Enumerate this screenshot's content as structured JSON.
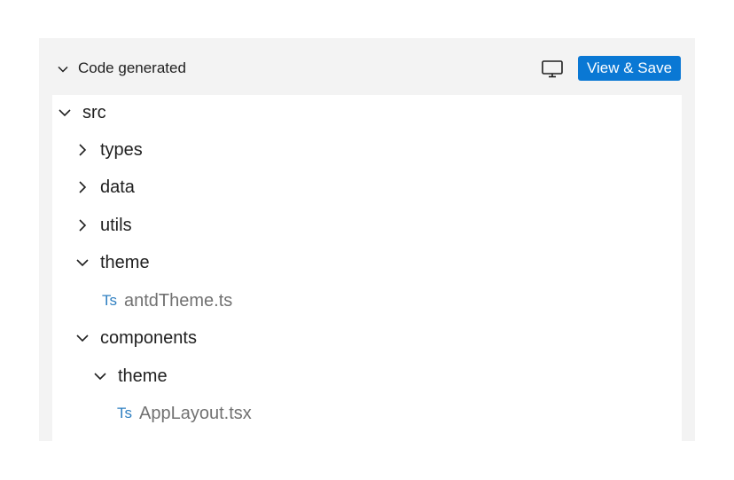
{
  "header": {
    "title": "Code generated",
    "view_save_label": "View & Save",
    "accent_color": "#0a78d4"
  },
  "tree": {
    "ts_icon_text": "Ts",
    "items": [
      {
        "label": "src",
        "type": "folder",
        "expanded": true,
        "depth": 0
      },
      {
        "label": "types",
        "type": "folder",
        "expanded": false,
        "depth": 1
      },
      {
        "label": "data",
        "type": "folder",
        "expanded": false,
        "depth": 1
      },
      {
        "label": "utils",
        "type": "folder",
        "expanded": false,
        "depth": 1
      },
      {
        "label": "theme",
        "type": "folder",
        "expanded": true,
        "depth": 1
      },
      {
        "label": "antdTheme.ts",
        "type": "file",
        "depth": 2
      },
      {
        "label": "components",
        "type": "folder",
        "expanded": true,
        "depth": 1
      },
      {
        "label": "theme",
        "type": "folder",
        "expanded": true,
        "depth": 2
      },
      {
        "label": "AppLayout.tsx",
        "type": "file",
        "depth": 3
      }
    ]
  }
}
